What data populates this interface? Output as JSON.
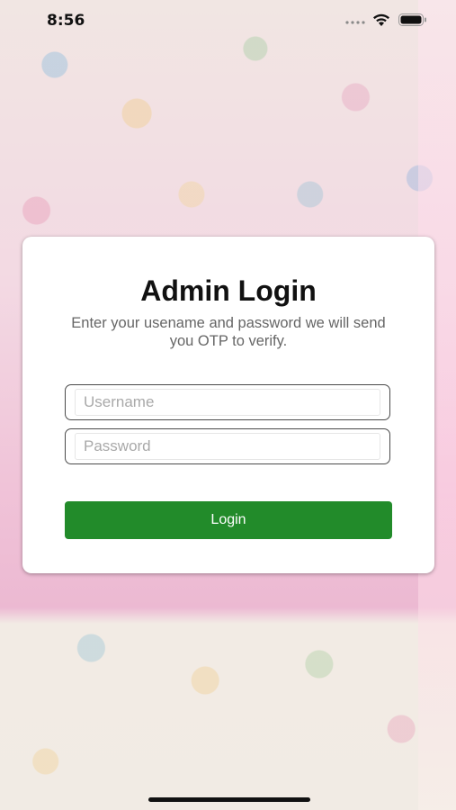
{
  "status_bar": {
    "time": "8:56",
    "icons": [
      "signal-icon",
      "wifi-icon",
      "battery-icon"
    ]
  },
  "login_card": {
    "title": "Admin Login",
    "subtitle": "Enter your usename and password we will send you OTP to verify.",
    "username": {
      "placeholder": "Username",
      "value": ""
    },
    "password": {
      "placeholder": "Password",
      "value": ""
    },
    "login_label": "Login"
  },
  "colors": {
    "button": "#228b2a",
    "card": "#ffffff",
    "background_tint": "#f0c3d8"
  }
}
